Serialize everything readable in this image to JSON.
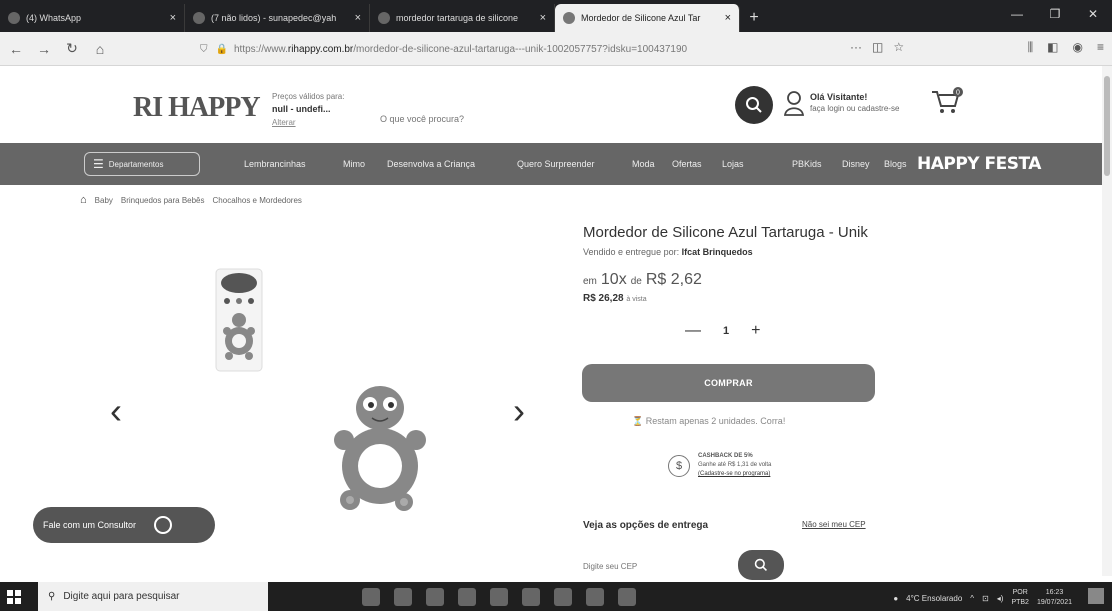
{
  "browser": {
    "tabs": [
      "(4) WhatsApp",
      "(7 não lidos) - sunapedec@yah",
      "mordedor tartaruga de silicone",
      "Mordedor de Silicone Azul Tar"
    ],
    "url_prefix": "https://www.",
    "url_domain": "rihappy.com.br",
    "url_path": "/mordedor-de-silicone-azul-tartaruga---unik-1002057757?idsku=100437190"
  },
  "site": {
    "logo": "RI HAPPY",
    "prices_label": "Preços válidos para:",
    "location": "null - undefi...",
    "change_label": "Alterar",
    "search_placeholder": "O que você procura?",
    "user_greeting": "Olá Visitante!",
    "user_login": "faça login ou cadastre-se",
    "cart_count": "0",
    "consultor_label": "Fale com um Consultor"
  },
  "nav": {
    "departments": "Departamentos",
    "items": [
      "Lembrancinhas",
      "Mimo",
      "Desenvolva a Criança",
      "Quero Surpreender",
      "Moda",
      "Ofertas",
      "Lojas",
      "PBKids",
      "Disney",
      "Blogs"
    ],
    "happy_festa": "HAPPY FESTA"
  },
  "breadcrumb": [
    "Baby",
    "Brinquedos para Bebês",
    "Chocalhos e Mordedores"
  ],
  "product": {
    "title": "Mordedor de Silicone Azul Tartaruga - Unik",
    "sold_by_label": "Vendido e entregue por:",
    "seller": "Ifcat Brinquedos",
    "installment_prefix": "em",
    "installment_count": "10x",
    "installment_of": "de",
    "installment_value": "R$ 2,62",
    "cash_price": "R$ 26,28",
    "cash_label": "à vista",
    "qty_minus": "—",
    "quantity": "1",
    "qty_plus": "+",
    "buy_label": "COMPRAR",
    "stock_notice": "Restam apenas 2 unidades. Corra!",
    "cashback_title": "CASHBACK DE 5%",
    "cashback_text": "Ganhe até R$ 1,31 de volta",
    "cashback_link": "(Cadastre-se no programa)",
    "delivery_title": "Veja as opções de entrega",
    "no_cep_label": "Não sei meu CEP",
    "cep_placeholder": "Digite seu CEP"
  },
  "taskbar": {
    "search_placeholder": "Digite aqui para pesquisar",
    "weather": "4°C Ensolarado",
    "lang1": "POR",
    "lang2": "PTB2",
    "time": "16:23",
    "date": "19/07/2021"
  }
}
